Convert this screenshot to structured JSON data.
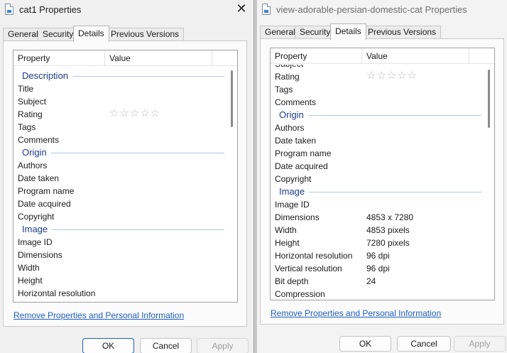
{
  "left_dialog": {
    "title": "cat1 Properties",
    "tabs": [
      "General",
      "Security",
      "Details",
      "Previous Versions"
    ],
    "active_tab": "Details",
    "columns": {
      "property": "Property",
      "value": "Value"
    },
    "rows": [
      {
        "kind": "group",
        "label": "Description"
      },
      {
        "kind": "item",
        "label": "Title",
        "value": ""
      },
      {
        "kind": "item",
        "label": "Subject",
        "value": ""
      },
      {
        "kind": "rating",
        "label": "Rating",
        "value": "☆☆☆☆☆"
      },
      {
        "kind": "item",
        "label": "Tags",
        "value": ""
      },
      {
        "kind": "item",
        "label": "Comments",
        "value": ""
      },
      {
        "kind": "group",
        "label": "Origin"
      },
      {
        "kind": "item",
        "label": "Authors",
        "value": ""
      },
      {
        "kind": "item",
        "label": "Date taken",
        "value": ""
      },
      {
        "kind": "item",
        "label": "Program name",
        "value": ""
      },
      {
        "kind": "item",
        "label": "Date acquired",
        "value": ""
      },
      {
        "kind": "item",
        "label": "Copyright",
        "value": ""
      },
      {
        "kind": "group",
        "label": "Image"
      },
      {
        "kind": "item",
        "label": "Image ID",
        "value": ""
      },
      {
        "kind": "item",
        "label": "Dimensions",
        "value": ""
      },
      {
        "kind": "item",
        "label": "Width",
        "value": ""
      },
      {
        "kind": "item",
        "label": "Height",
        "value": ""
      },
      {
        "kind": "item",
        "label": "Horizontal resolution",
        "value": ""
      }
    ],
    "remove_link": "Remove Properties and Personal Information",
    "buttons": {
      "ok": "OK",
      "cancel": "Cancel",
      "apply": "Apply"
    }
  },
  "right_dialog": {
    "title": "view-adorable-persian-domestic-cat Properties",
    "tabs": [
      "General",
      "Security",
      "Details",
      "Previous Versions"
    ],
    "active_tab": "Details",
    "columns": {
      "property": "Property",
      "value": "Value"
    },
    "rows": [
      {
        "kind": "item",
        "label": "Subject",
        "value": ""
      },
      {
        "kind": "rating",
        "label": "Rating",
        "value": "☆☆☆☆☆"
      },
      {
        "kind": "item",
        "label": "Tags",
        "value": ""
      },
      {
        "kind": "item",
        "label": "Comments",
        "value": ""
      },
      {
        "kind": "group",
        "label": "Origin"
      },
      {
        "kind": "item",
        "label": "Authors",
        "value": ""
      },
      {
        "kind": "item",
        "label": "Date taken",
        "value": ""
      },
      {
        "kind": "item",
        "label": "Program name",
        "value": ""
      },
      {
        "kind": "item",
        "label": "Date acquired",
        "value": ""
      },
      {
        "kind": "item",
        "label": "Copyright",
        "value": ""
      },
      {
        "kind": "group",
        "label": "Image"
      },
      {
        "kind": "item",
        "label": "Image ID",
        "value": ""
      },
      {
        "kind": "item",
        "label": "Dimensions",
        "value": "4853 x 7280"
      },
      {
        "kind": "item",
        "label": "Width",
        "value": "4853 pixels"
      },
      {
        "kind": "item",
        "label": "Height",
        "value": "7280 pixels"
      },
      {
        "kind": "item",
        "label": "Horizontal resolution",
        "value": "96 dpi"
      },
      {
        "kind": "item",
        "label": "Vertical resolution",
        "value": "96 dpi"
      },
      {
        "kind": "item",
        "label": "Bit depth",
        "value": "24"
      },
      {
        "kind": "item",
        "label": "Compression",
        "value": ""
      }
    ],
    "remove_link": "Remove Properties and Personal Information",
    "buttons": {
      "ok": "OK",
      "cancel": "Cancel",
      "apply": "Apply"
    }
  }
}
